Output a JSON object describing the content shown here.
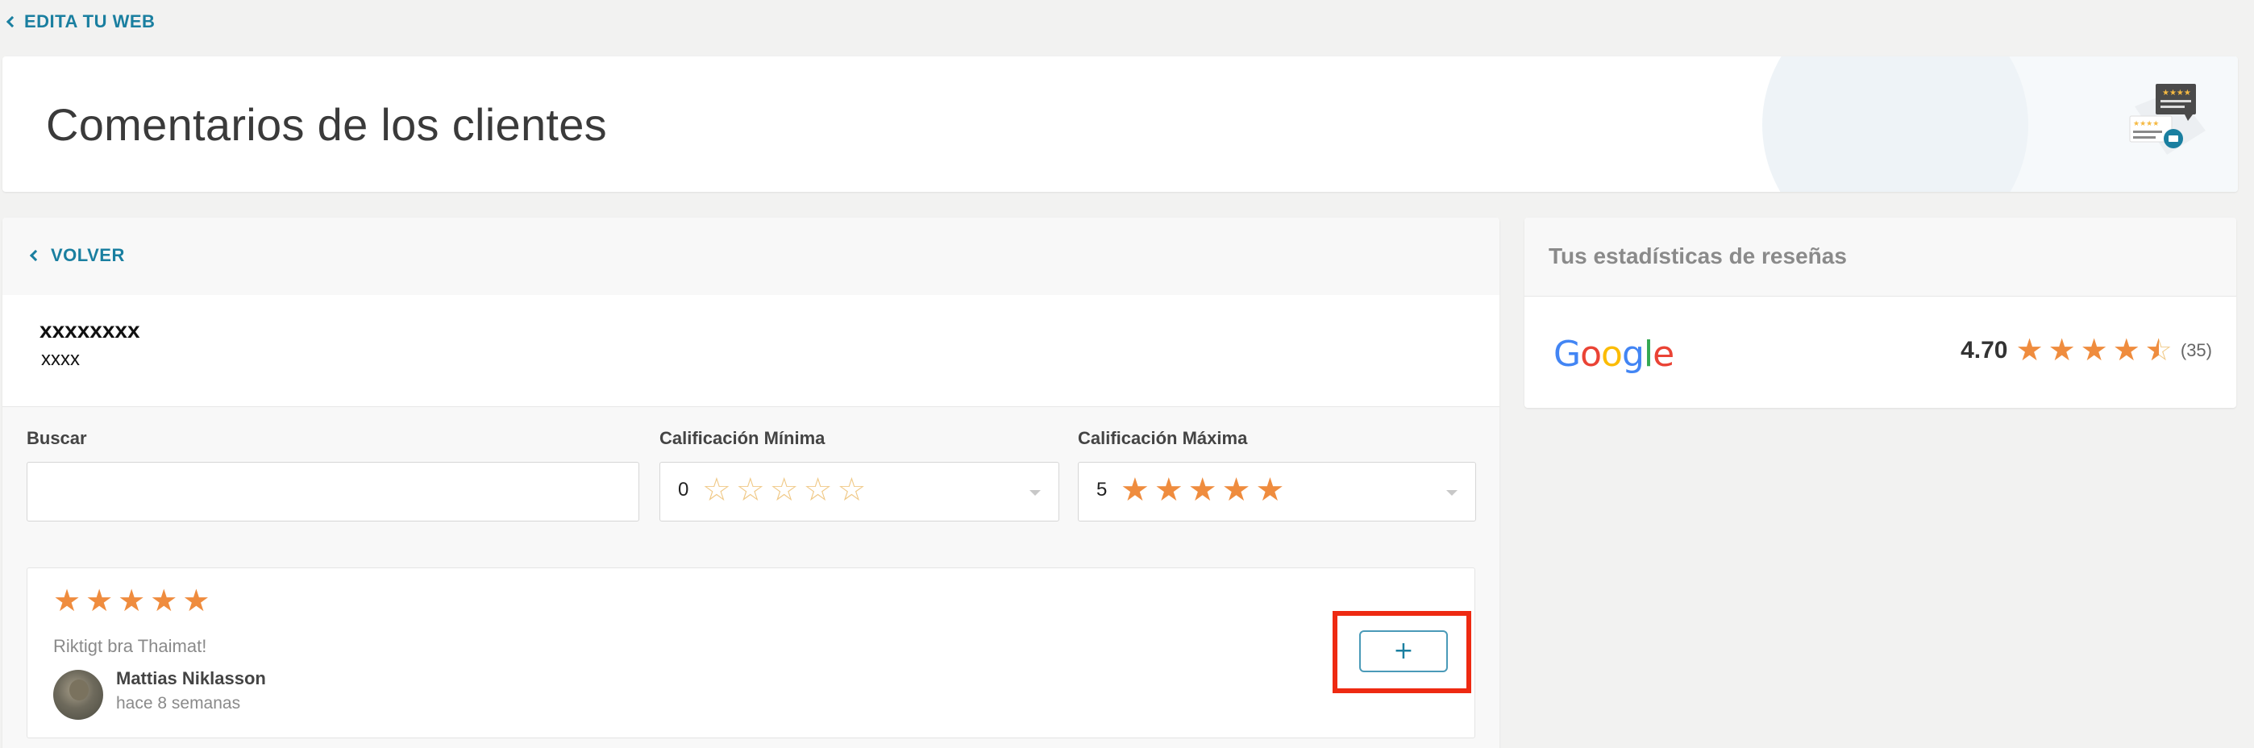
{
  "nav": {
    "edit_web_label": "EDITA TU WEB"
  },
  "header": {
    "title": "Comentarios de los clientes",
    "icon": "reviews-illustration-icon"
  },
  "main": {
    "back_label": "VOLVER",
    "business": {
      "name": "xxxxxxxx",
      "subtitle": "xxxx"
    },
    "filters": {
      "search": {
        "label": "Buscar",
        "value": ""
      },
      "min_rating": {
        "label": "Calificación Mínima",
        "value": "0",
        "stars_filled": 0
      },
      "max_rating": {
        "label": "Calificación Máxima",
        "value": "5",
        "stars_filled": 5
      }
    },
    "reviews": [
      {
        "stars": 5,
        "text": "Riktigt bra Thaimat!",
        "author": "Mattias Niklasson",
        "date": "hace 8 semanas",
        "action_label": "+"
      }
    ]
  },
  "stats": {
    "title": "Tus estadísticas de reseñas",
    "source": "Google",
    "rating": "4.70",
    "count": "(35)",
    "stars_value": 4.7
  },
  "colors": {
    "accent": "#1a7fa0",
    "star": "#ef8c3e",
    "star_empty": "#f0c987",
    "highlight": "#ee2a12"
  }
}
